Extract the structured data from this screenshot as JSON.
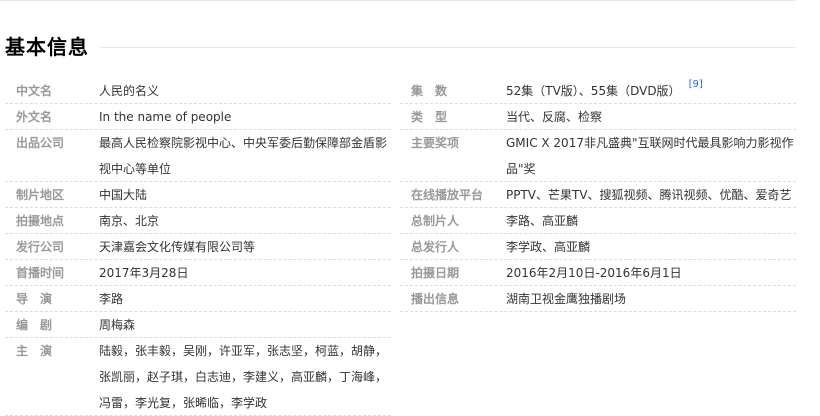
{
  "section": {
    "title": "基本信息"
  },
  "left": [
    {
      "label": "中文名",
      "value": "人民的名义"
    },
    {
      "label": "外文名",
      "value": "In the name of people"
    },
    {
      "label": "出品公司",
      "value": "最高人民检察院影视中心、中央军委后勤保障部金盾影视中心等单位"
    },
    {
      "label": "制片地区",
      "value": "中国大陆"
    },
    {
      "label": "拍摄地点",
      "value": "南京、北京"
    },
    {
      "label": "发行公司",
      "value": "天津嘉会文化传媒有限公司等"
    },
    {
      "label": "首播时间",
      "value": "2017年3月28日"
    },
    {
      "label": "导　演",
      "value": "李路"
    },
    {
      "label": "编　剧",
      "value": "周梅森"
    },
    {
      "label": "主　演",
      "value": "陆毅，张丰毅，吴刚，许亚军，张志坚，柯蓝，胡静，张凯丽，赵子琪，白志迪，李建义，高亚麟，丁海峰，冯雷，李光复，张晞临，李学政"
    }
  ],
  "right": [
    {
      "label": "集　数",
      "value": "52集（TV版）、55集（DVD版）",
      "ref": "[9]"
    },
    {
      "label": "类　型",
      "value": "当代、反腐、检察"
    },
    {
      "label": "主要奖项",
      "value": "GMIC X 2017非凡盛典\"互联网时代最具影响力影视作品\"奖"
    },
    {
      "label": "在线播放平台",
      "value": "PPTV、芒果TV、搜狐视频、腾讯视频、优酷、爱奇艺"
    },
    {
      "label": "总制片人",
      "value": "李路、高亚麟"
    },
    {
      "label": "总发行人",
      "value": "李学政、高亚麟"
    },
    {
      "label": "拍摄日期",
      "value": "2016年2月10日-2016年6月1日"
    },
    {
      "label": "播出信息",
      "value": "湖南卫视金鹰独播剧场"
    }
  ]
}
